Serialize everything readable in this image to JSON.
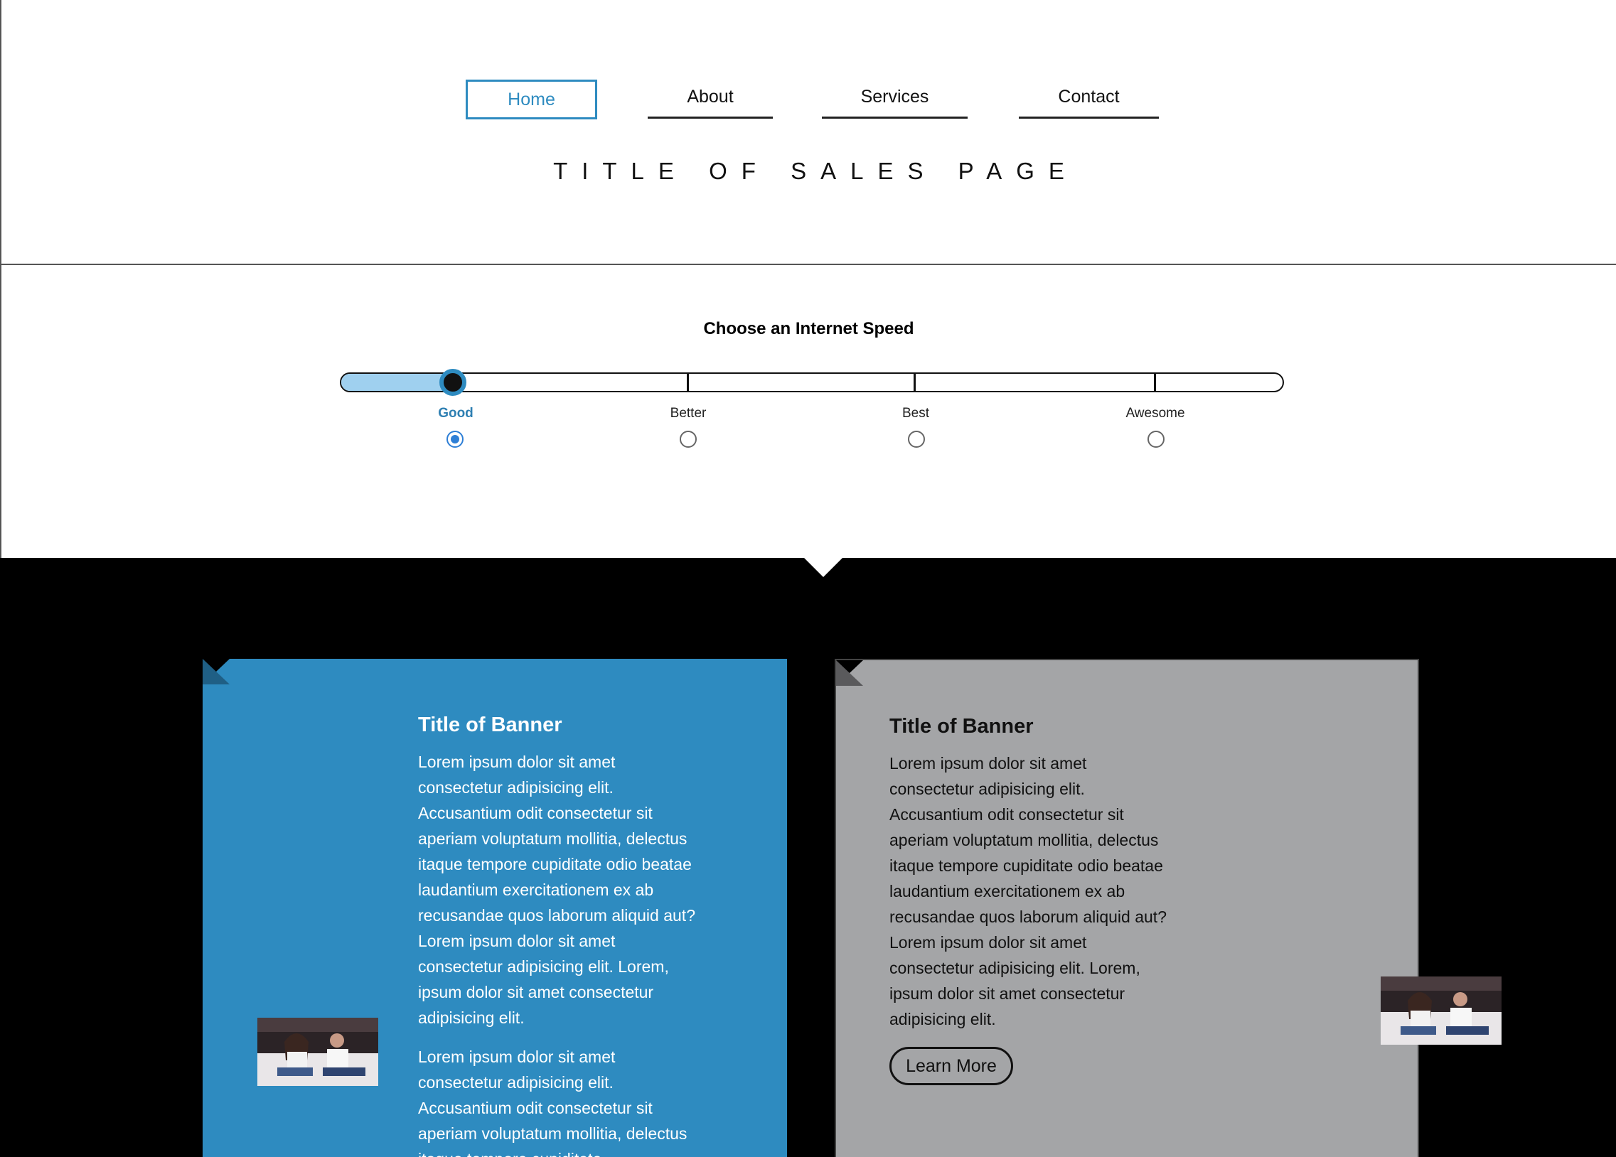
{
  "nav": {
    "items": [
      {
        "label": "Home",
        "active": true
      },
      {
        "label": "About",
        "active": false
      },
      {
        "label": "Services",
        "active": false
      },
      {
        "label": "Contact",
        "active": false
      }
    ]
  },
  "page": {
    "title": "TITLE OF SALES PAGE"
  },
  "speed": {
    "heading": "Choose an Internet Speed",
    "options": [
      "Good",
      "Better",
      "Best",
      "Awesome"
    ],
    "selected": "Good"
  },
  "banners": [
    {
      "title": "Title of Banner",
      "paragraph1": "Lorem ipsum dolor sit amet consectetur adipisicing elit. Accusantium odit consectetur sit aperiam voluptatum mollitia, delectus itaque tempore cupiditate odio beatae laudantium exercitationem ex ab recusandae quos laborum aliquid aut? Lorem ipsum dolor sit amet consectetur adipisicing elit. Lorem, ipsum dolor sit amet consectetur adipisicing elit.",
      "paragraph2": "Lorem ipsum dolor sit amet consectetur adipisicing elit. Accusantium odit consectetur sit aperiam voluptatum mollitia, delectus itaque tempore cupiditate",
      "color": "#2e8bc0"
    },
    {
      "title": "Title of Banner",
      "paragraph1": "Lorem ipsum dolor sit amet consectetur adipisicing elit. Accusantium odit consectetur sit aperiam voluptatum mollitia, delectus itaque tempore cupiditate odio beatae laudantium exercitationem ex ab recusandae quos laborum aliquid aut? Lorem ipsum dolor sit amet consectetur adipisicing elit. Lorem, ipsum dolor sit amet consectetur adipisicing elit.",
      "button_label": "Learn More",
      "color": "#a4a5a7"
    }
  ],
  "colors": {
    "accent": "#2e8bc0",
    "slider_fill": "#9fd0ef",
    "dark_background": "#000000"
  }
}
